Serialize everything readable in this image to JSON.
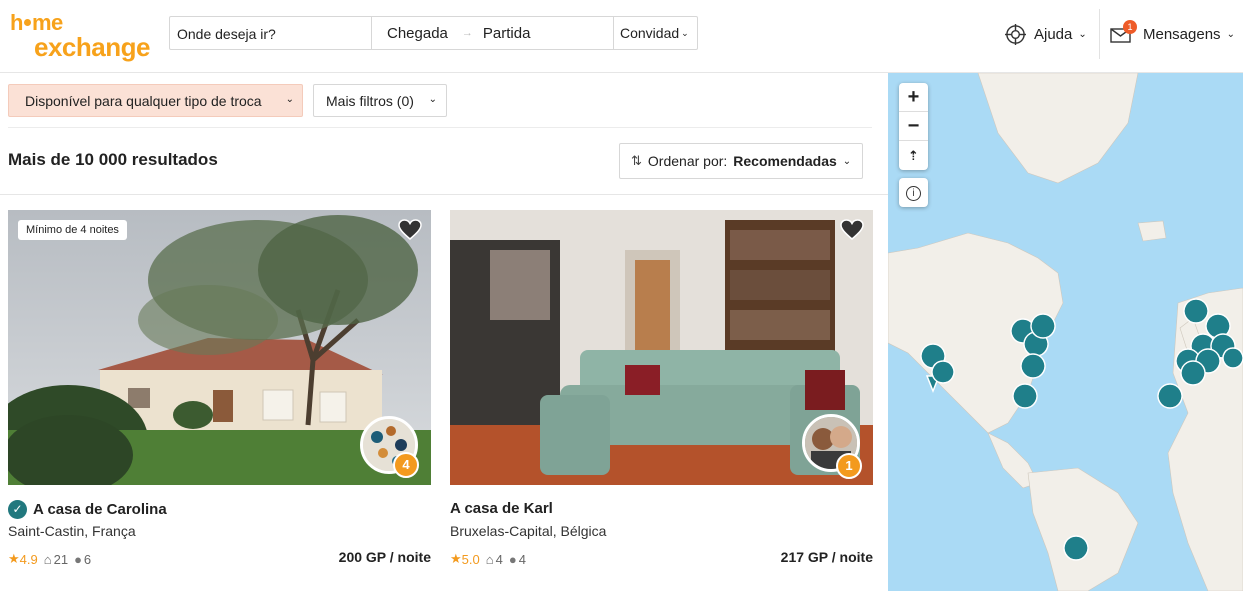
{
  "header": {
    "logo_top": "h me",
    "logo_bottom": "exchange",
    "search_placeholder": "Onde deseja ir?",
    "checkin": "Chegada",
    "checkout": "Partida",
    "guests": "Convidad",
    "help": "Ajuda",
    "messages": "Mensagens",
    "messages_badge": "1"
  },
  "filters": {
    "exchange_type": "Disponível para qualquer tipo de troca",
    "more_filters": "Mais filtros (0)"
  },
  "results": {
    "count_label": "Mais de 10 000 resultados",
    "sort_prefix": "Ordenar por:",
    "sort_value": "Recomendadas"
  },
  "listings": [
    {
      "badge": "Mínimo de 4 noites",
      "title": "A casa de Carolina",
      "location": "Saint-Castin, França",
      "rating": "4.9",
      "beds": "21",
      "guests": "6",
      "price": "200 GP / noite",
      "level": "4",
      "verified": true
    },
    {
      "title": "A casa de Karl",
      "location": "Bruxelas-Capital, Bélgica",
      "rating": "5.0",
      "beds": "4",
      "guests": "4",
      "price": "217 GP / noite",
      "level": "1",
      "verified": false
    }
  ],
  "map": {
    "zoom_in": "+",
    "zoom_out": "−",
    "reset": "⇡",
    "info": "i",
    "marker_color": "#1f7f8a",
    "land_color": "#f2efe9",
    "water_color": "#aadaf5"
  },
  "colors": {
    "brand": "#f7a21b",
    "accent_filter": "#fbe1d6",
    "notification": "#ee5b28",
    "verified": "#21787e"
  }
}
